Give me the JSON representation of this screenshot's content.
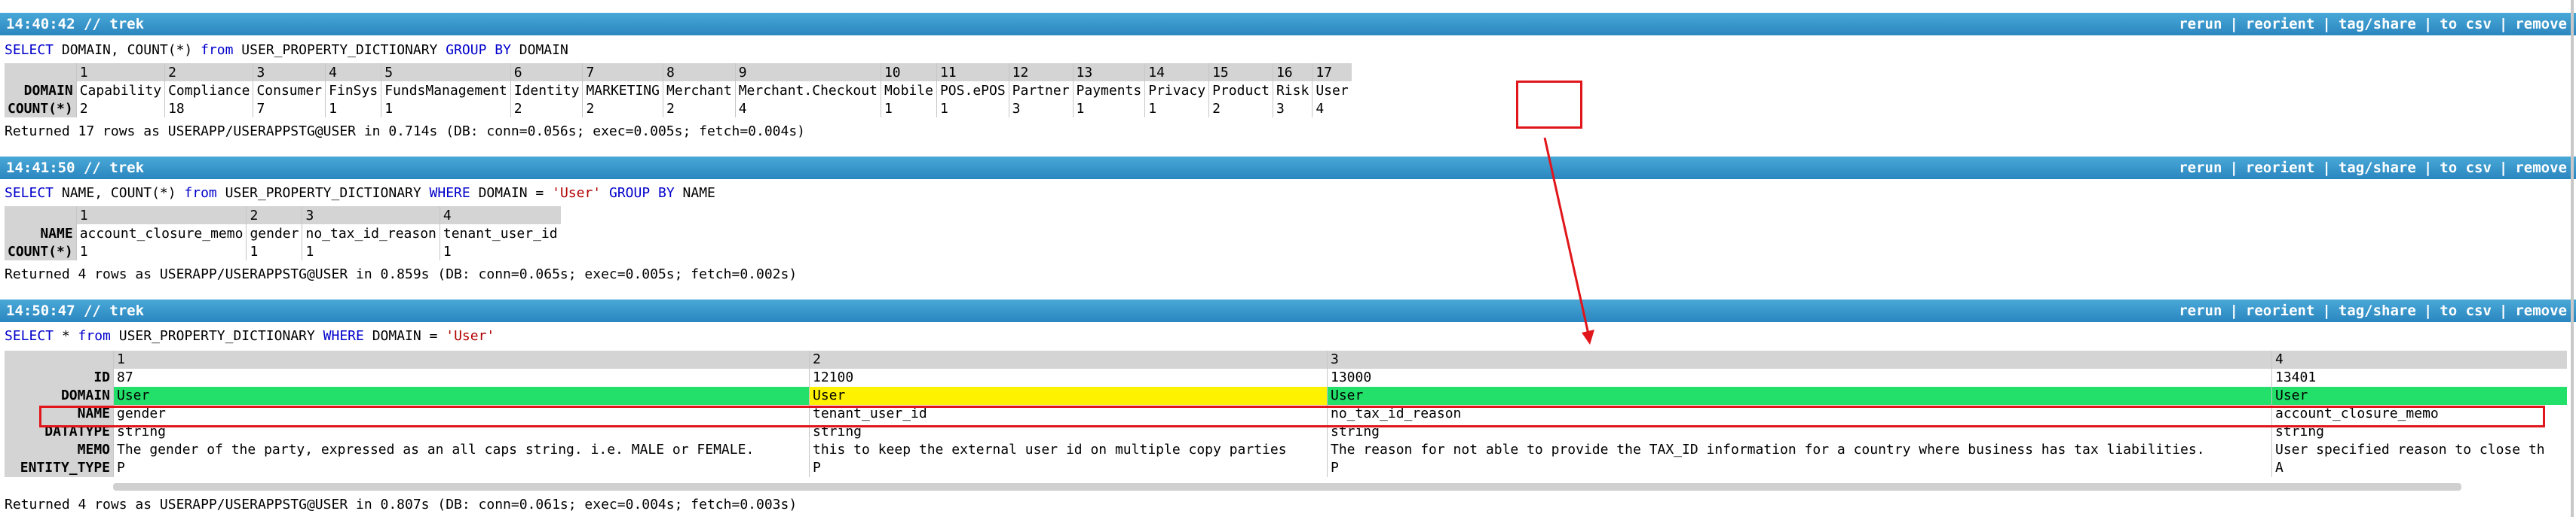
{
  "colors": {
    "bar": "#2a86bf",
    "highlight_green": "#22e06a",
    "highlight_yellow": "#fff200",
    "annotation_red": "#e0161b"
  },
  "actions": [
    "rerun",
    "reorient",
    "tag/share",
    "to csv",
    "remove"
  ],
  "queries": [
    {
      "title": "14:40:42 // trek",
      "sql": {
        "kw1": "SELECT",
        "t1": " DOMAIN, COUNT(*) ",
        "kw2": "from",
        "t2": " USER_PROPERTY_DICTIONARY ",
        "kw3": "GROUP BY",
        "t3": " DOMAIN"
      },
      "row_headers": [
        "DOMAIN",
        "COUNT(*)"
      ],
      "columns": [
        {
          "idx": "1",
          "DOMAIN": "Capability",
          "COUNT": "2"
        },
        {
          "idx": "2",
          "DOMAIN": "Compliance",
          "COUNT": "18"
        },
        {
          "idx": "3",
          "DOMAIN": "Consumer",
          "COUNT": "7"
        },
        {
          "idx": "4",
          "DOMAIN": "FinSys",
          "COUNT": "1"
        },
        {
          "idx": "5",
          "DOMAIN": "FundsManagement",
          "COUNT": "1"
        },
        {
          "idx": "6",
          "DOMAIN": "Identity",
          "COUNT": "2"
        },
        {
          "idx": "7",
          "DOMAIN": "MARKETING",
          "COUNT": "2"
        },
        {
          "idx": "8",
          "DOMAIN": "Merchant",
          "COUNT": "2"
        },
        {
          "idx": "9",
          "DOMAIN": "Merchant.Checkout",
          "COUNT": "4"
        },
        {
          "idx": "10",
          "DOMAIN": "Mobile",
          "COUNT": "1"
        },
        {
          "idx": "11",
          "DOMAIN": "POS.ePOS",
          "COUNT": "1"
        },
        {
          "idx": "12",
          "DOMAIN": "Partner",
          "COUNT": "3"
        },
        {
          "idx": "13",
          "DOMAIN": "Payments",
          "COUNT": "1"
        },
        {
          "idx": "14",
          "DOMAIN": "Privacy",
          "COUNT": "1"
        },
        {
          "idx": "15",
          "DOMAIN": "Product",
          "COUNT": "2"
        },
        {
          "idx": "16",
          "DOMAIN": "Risk",
          "COUNT": "3"
        },
        {
          "idx": "17",
          "DOMAIN": "User",
          "COUNT": "4"
        }
      ],
      "status": "Returned 17 rows as USERAPP/USERAPPSTG@USER in 0.714s (DB: conn=0.056s; exec=0.005s; fetch=0.004s)"
    },
    {
      "title": "14:41:50 // trek",
      "sql": {
        "kw1": "SELECT",
        "t1": " NAME, COUNT(*) ",
        "kw2": "from",
        "t2": " USER_PROPERTY_DICTIONARY ",
        "kw3": "WHERE",
        "t3": " DOMAIN = ",
        "str": "'User'",
        "kw4": "GROUP BY",
        "t4": " NAME"
      },
      "row_headers": [
        "NAME",
        "COUNT(*)"
      ],
      "columns": [
        {
          "idx": "1",
          "NAME": "account_closure_memo",
          "COUNT": "1"
        },
        {
          "idx": "2",
          "NAME": "gender",
          "COUNT": "1"
        },
        {
          "idx": "3",
          "NAME": "no_tax_id_reason",
          "COUNT": "1"
        },
        {
          "idx": "4",
          "NAME": "tenant_user_id",
          "COUNT": "1"
        }
      ],
      "status": "Returned 4 rows as USERAPP/USERAPPSTG@USER in 0.859s (DB: conn=0.065s; exec=0.005s; fetch=0.002s)"
    },
    {
      "title": "14:50:47 // trek",
      "sql": {
        "kw1": "SELECT",
        "t1": " * ",
        "kw2": "from",
        "t2": " USER_PROPERTY_DICTIONARY ",
        "kw3": "WHERE",
        "t3": " DOMAIN = ",
        "str": "'User'"
      },
      "row_headers": [
        "ID",
        "DOMAIN",
        "NAME",
        "DATATYPE",
        "MEMO",
        "ENTITY_TYPE"
      ],
      "columns": [
        {
          "idx": "1",
          "ID": "87",
          "DOMAIN": "User",
          "NAME": "gender",
          "DATATYPE": "string",
          "MEMO": "The gender of the party, expressed as an all caps string. i.e. MALE or FEMALE.",
          "ENTITY_TYPE": "P"
        },
        {
          "idx": "2",
          "ID": "12100",
          "DOMAIN": "User",
          "NAME": "tenant_user_id",
          "DATATYPE": "string",
          "MEMO": "this to keep the external user id on multiple copy parties",
          "ENTITY_TYPE": "P"
        },
        {
          "idx": "3",
          "ID": "13000",
          "DOMAIN": "User",
          "NAME": "no_tax_id_reason",
          "DATATYPE": "string",
          "MEMO": "The reason for not able to provide the TAX_ID information for a country where business has tax liabilities.",
          "ENTITY_TYPE": "P"
        },
        {
          "idx": "4",
          "ID": "13401",
          "DOMAIN": "User",
          "NAME": "account_closure_memo",
          "DATATYPE": "string",
          "MEMO": "User specified reason to close th",
          "ENTITY_TYPE": "A"
        }
      ],
      "status": "Returned 4 rows as USERAPP/USERAPPSTG@USER in 0.807s (DB: conn=0.061s; exec=0.004s; fetch=0.003s)"
    }
  ]
}
